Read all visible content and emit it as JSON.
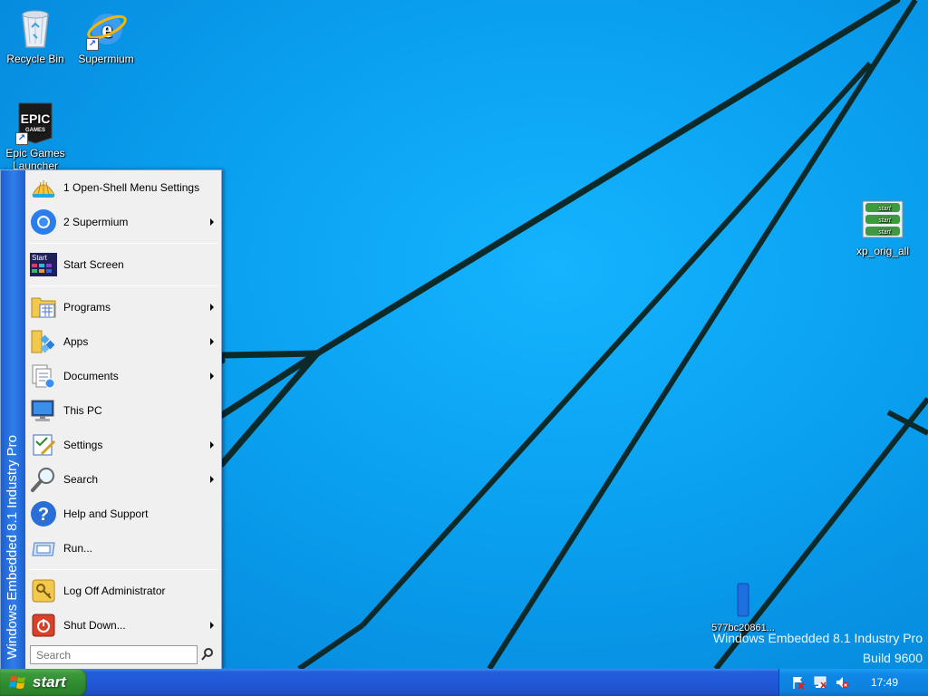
{
  "desktop": {
    "icons": [
      {
        "label": "Recycle Bin",
        "icon": "recycle-bin-icon"
      },
      {
        "label": "Supermium",
        "icon": "supermium-browser-icon"
      },
      {
        "label": "Epic Games Launcher",
        "icon": "epic-games-icon"
      },
      {
        "label": "xp_orig_all",
        "icon": "image-file-icon"
      },
      {
        "label": "577bc20861...",
        "icon": "file-icon"
      }
    ],
    "epic_logo_line1": "EPIC",
    "epic_logo_line2": "GAMES",
    "xp_orig_thumb_label": "start",
    "watermark": {
      "line1": "Windows Embedded 8.1 Industry Pro",
      "line2": "Build 9600"
    }
  },
  "start_menu": {
    "banner": "Windows Embedded 8.1 Industry Pro",
    "start_screen_icon_label": "Start",
    "items": [
      {
        "label": "1 Open-Shell Menu Settings",
        "icon": "open-shell-icon",
        "submenu": false
      },
      {
        "label": "2 Supermium",
        "icon": "supermium-icon",
        "submenu": true
      },
      {
        "label": "Start Screen",
        "icon": "start-screen-icon",
        "submenu": false
      },
      {
        "label": "Programs",
        "icon": "programs-icon",
        "submenu": true
      },
      {
        "label": "Apps",
        "icon": "apps-icon",
        "submenu": true
      },
      {
        "label": "Documents",
        "icon": "documents-icon",
        "submenu": true
      },
      {
        "label": "This PC",
        "icon": "this-pc-icon",
        "submenu": false
      },
      {
        "label": "Settings",
        "icon": "settings-icon",
        "submenu": true
      },
      {
        "label": "Search",
        "icon": "search-icon",
        "submenu": true
      },
      {
        "label": "Help and Support",
        "icon": "help-icon",
        "submenu": false
      },
      {
        "label": "Run...",
        "icon": "run-icon",
        "submenu": false
      },
      {
        "label": "Log Off Administrator",
        "icon": "log-off-icon",
        "submenu": false
      },
      {
        "label": "Shut Down...",
        "icon": "shut-down-icon",
        "submenu": true
      }
    ],
    "search_placeholder": "Search"
  },
  "taskbar": {
    "start_label": "start",
    "clock": "17:49",
    "tray_icons": [
      "action-center-flag-icon",
      "network-icon",
      "volume-muted-icon"
    ]
  },
  "colors": {
    "desktop_bg": "#0a9bea",
    "taskbar_blue": "#245edb",
    "start_green": "#3c9b3c",
    "tray_blue": "#0f88e6"
  }
}
